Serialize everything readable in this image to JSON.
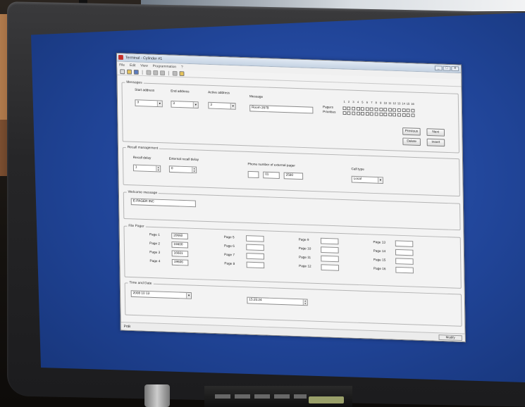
{
  "window": {
    "title": "Terminal - Cylinder #1",
    "menu": [
      "File",
      "Edit",
      "View",
      "Programmation",
      "?"
    ],
    "controls": [
      "_",
      "□",
      "X"
    ]
  },
  "messages": {
    "group_title": "Messages",
    "start_address_label": "Start address",
    "start_address_value": "3",
    "end_address_label": "End address",
    "end_address_value": "3",
    "active_address_label": "Active address",
    "active_address_value": "3",
    "message_label": "Message",
    "message_value": "Room 2678",
    "pagers_label": "Pagers",
    "priorities_label": "Priorities",
    "pager_numbers": [
      "1",
      "2",
      "3",
      "4",
      "5",
      "6",
      "7",
      "8",
      "9",
      "10",
      "11",
      "12",
      "13",
      "14",
      "15",
      "16"
    ],
    "pagers_prefix": "1 2",
    "buttons": {
      "previous": "Previous",
      "next": "Next",
      "delete": "Delete",
      "insert": "Insert"
    }
  },
  "recall": {
    "group_title": "Recall management",
    "recall_delay_label": "Recall delay",
    "recall_delay_value": "1",
    "external_recall_delay_label": "External recall delay",
    "external_recall_delay_value": "0",
    "phone_label": "Phone number of external pager",
    "phone_parts": [
      "",
      "01",
      "2580"
    ],
    "call_type_label": "Call type",
    "call_type_value": "Local"
  },
  "welcome": {
    "group_title": "Welcome message",
    "value": "E-PAGER INC"
  },
  "pager_file": {
    "group_title": "File Pager",
    "pages": [
      {
        "label": "Page 1",
        "value": "20660"
      },
      {
        "label": "Page 2",
        "value": "16600"
      },
      {
        "label": "Page 3",
        "value": "16601"
      },
      {
        "label": "Page 4",
        "value": "19606"
      },
      {
        "label": "Page 5",
        "value": ""
      },
      {
        "label": "Page 6",
        "value": ""
      },
      {
        "label": "Page 7",
        "value": ""
      },
      {
        "label": "Page 8",
        "value": ""
      },
      {
        "label": "Page 9",
        "value": ""
      },
      {
        "label": "Page 10",
        "value": ""
      },
      {
        "label": "Page 11",
        "value": ""
      },
      {
        "label": "Page 12",
        "value": ""
      },
      {
        "label": "Page 13",
        "value": ""
      },
      {
        "label": "Page 14",
        "value": ""
      },
      {
        "label": "Page 15",
        "value": ""
      },
      {
        "label": "Page 16",
        "value": ""
      }
    ]
  },
  "time_date": {
    "group_title": "Time and Date",
    "date_value": "2008 10 13",
    "time_value": "15:25:24"
  },
  "status": {
    "left": "PrtB",
    "right": "Modify"
  }
}
